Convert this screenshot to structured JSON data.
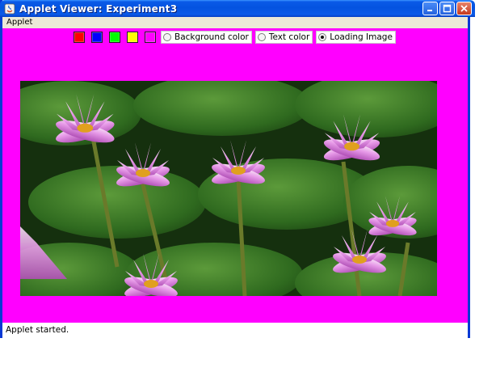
{
  "window": {
    "title": "Applet Viewer: Experiment3",
    "controls": [
      "minimize",
      "maximize",
      "close"
    ]
  },
  "menu": {
    "items": [
      {
        "label": "Applet"
      }
    ]
  },
  "applet": {
    "background_color": "#ff00ff",
    "swatches": [
      {
        "name": "red",
        "color": "#ff0000"
      },
      {
        "name": "blue",
        "color": "#0000ff"
      },
      {
        "name": "green",
        "color": "#00ff00"
      },
      {
        "name": "yellow",
        "color": "#ffff00"
      },
      {
        "name": "magenta",
        "color": "#ff00ff"
      }
    ],
    "options": [
      {
        "label": "Background color",
        "selected": false
      },
      {
        "label": "Text color",
        "selected": false
      },
      {
        "label": "Loading Image",
        "selected": true
      }
    ],
    "image": {
      "subject": "pink water lilies on green lily pads"
    }
  },
  "status": {
    "text": "Applet started."
  }
}
